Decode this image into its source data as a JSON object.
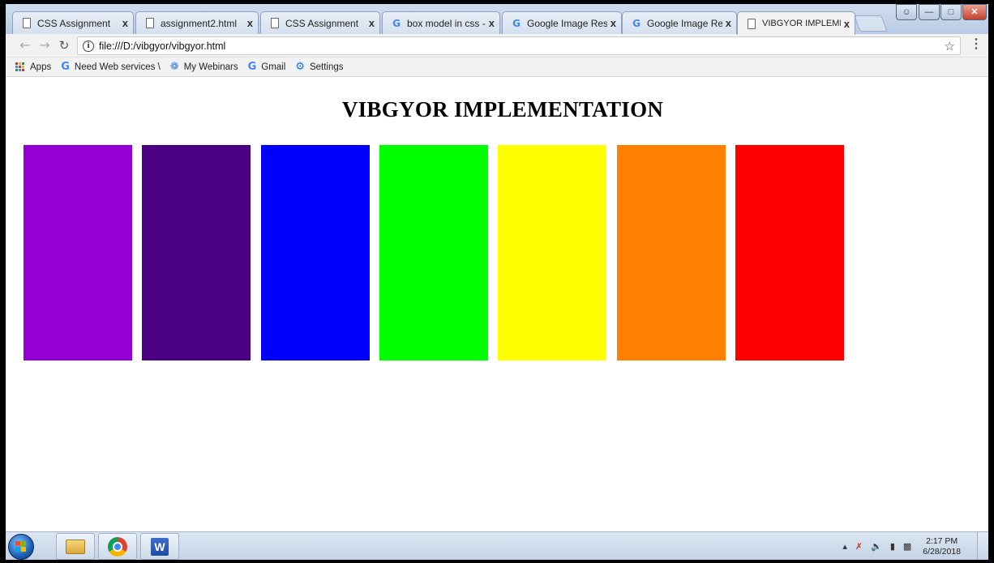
{
  "browser": {
    "tabs": [
      {
        "label": "CSS Assignment",
        "icon": "document-icon",
        "close": "x"
      },
      {
        "label": "assignment2.html",
        "icon": "document-icon",
        "close": "x"
      },
      {
        "label": "CSS Assignment",
        "icon": "document-icon",
        "close": "x"
      },
      {
        "label": "box model in css - G",
        "icon": "google-icon",
        "close": "x"
      },
      {
        "label": "Google Image Resul",
        "icon": "google-icon",
        "close": "x"
      },
      {
        "label": "Google Image Resu",
        "icon": "google-icon",
        "close": "x"
      },
      {
        "label": "VIBGYOR IMPLEMEN",
        "icon": "document-icon",
        "close": "x",
        "active": true
      }
    ],
    "address": {
      "url": "file:///D:/vibgyor/vibgyor.html"
    },
    "bookmarks": [
      {
        "label": "Apps",
        "icon": "apps-grid-icon"
      },
      {
        "label": "Need Web services \\",
        "icon": "google-icon"
      },
      {
        "label": "My Webinars",
        "icon": "webinar-icon"
      },
      {
        "label": "Gmail",
        "icon": "google-icon"
      },
      {
        "label": "Settings",
        "icon": "gear-icon"
      }
    ]
  },
  "page": {
    "title": "VIBGYOR IMPLEMENTATION",
    "stripes": [
      {
        "name": "violet",
        "color": "#9400D3"
      },
      {
        "name": "indigo",
        "color": "#4B0082"
      },
      {
        "name": "blue",
        "color": "#0000FF"
      },
      {
        "name": "green",
        "color": "#00FF00"
      },
      {
        "name": "yellow",
        "color": "#FFFF00"
      },
      {
        "name": "orange",
        "color": "#FF7F00"
      },
      {
        "name": "red",
        "color": "#FF0000"
      }
    ]
  },
  "taskbar": {
    "clock_time": "2:17 PM",
    "clock_date": "6/28/2018",
    "word_letter": "W"
  }
}
